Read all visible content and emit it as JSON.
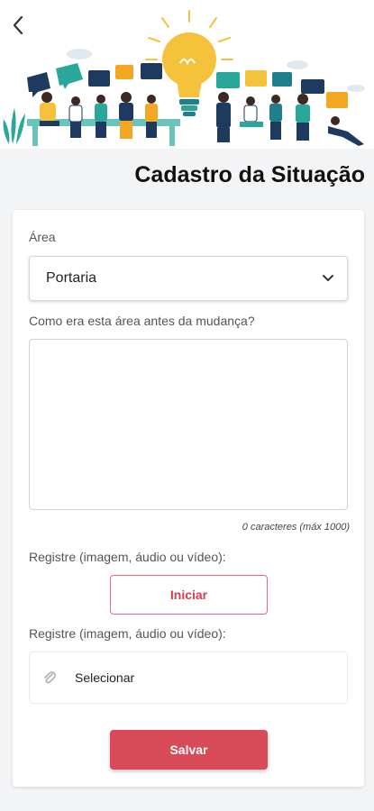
{
  "header": {
    "title": "Cadastro da Situação"
  },
  "form": {
    "area_label": "Área",
    "area_value": "Portaria",
    "before_label": "Como era esta área antes da mudança?",
    "before_value": "",
    "counter": "0 caracteres (máx 1000)",
    "record_label_1": "Registre (imagem, áudio ou vídeo):",
    "start_button": "Iniciar",
    "record_label_2": "Registre (imagem, áudio ou vídeo):",
    "select_file": "Selecionar",
    "save_button": "Salvar"
  },
  "icons": {
    "back": "chevron-left-icon",
    "dropdown": "chevron-down-icon",
    "attach": "paperclip-icon"
  },
  "colors": {
    "accent": "#d94a59",
    "bulb": "#f5c33b",
    "teal": "#2aa79b",
    "navy": "#1f3a5f"
  }
}
